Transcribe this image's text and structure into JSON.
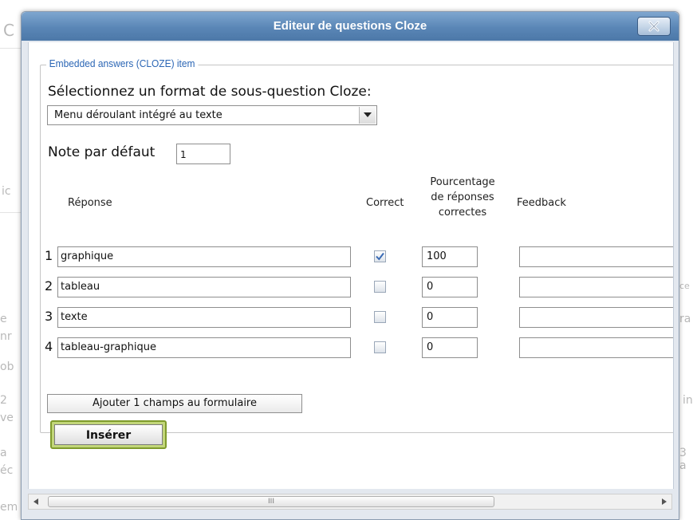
{
  "dialog": {
    "title": "Editeur de questions Cloze",
    "legend": "Embedded answers (CLOZE) item",
    "format_label": "Sélectionnez un format de sous-question Cloze:",
    "format_selected": "Menu déroulant intégré au texte",
    "default_grade_label": "Note par défaut",
    "default_grade_value": "1",
    "headers": {
      "answer": "Réponse",
      "correct": "Correct",
      "percentage_line1": "Pourcentage",
      "percentage_line2": "de réponses",
      "percentage_line3": "correctes",
      "feedback": "Feedback"
    },
    "rows": [
      {
        "num": "1",
        "answer": "graphique",
        "correct": true,
        "percentage": "100",
        "feedback": ""
      },
      {
        "num": "2",
        "answer": "tableau",
        "correct": false,
        "percentage": "0",
        "feedback": ""
      },
      {
        "num": "3",
        "answer": "texte",
        "correct": false,
        "percentage": "0",
        "feedback": ""
      },
      {
        "num": "4",
        "answer": "tableau-graphique",
        "correct": false,
        "percentage": "0",
        "feedback": ""
      }
    ],
    "add_fields_label": "Ajouter 1 champs au formulaire",
    "insert_label": "Insérer",
    "scroll_grip": "III"
  },
  "background": {
    "fragments": [
      "C",
      "ic",
      "n",
      "e",
      "c",
      "nr",
      "ob",
      "2",
      "ve",
      "a",
      "éc",
      "em",
      "ra",
      "in",
      "3 a",
      "ce"
    ]
  },
  "colors": {
    "titlebar": "#5a86b6",
    "legend_text": "#2b66b5",
    "insert_border": "#7f9b2c",
    "checkbox_tick": "#3a6bb5"
  },
  "icons": {
    "close": "close-icon",
    "dropdown": "chevron-down-icon",
    "checkmark": "checkmark-icon",
    "scroll_left": "arrow-left-icon",
    "scroll_right": "arrow-right-icon"
  }
}
